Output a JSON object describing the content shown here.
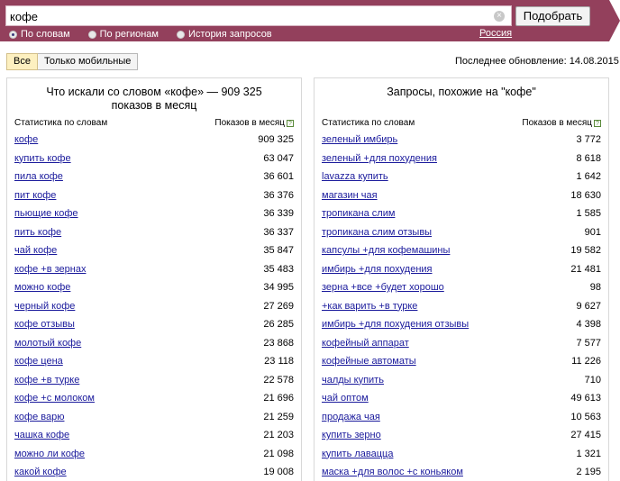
{
  "search": {
    "value": "кофе",
    "clear_icon": "×",
    "submit_label": "Подобрать"
  },
  "tabs": [
    {
      "label": "По словам",
      "selected": true
    },
    {
      "label": "По регионам",
      "selected": false
    },
    {
      "label": "История запросов",
      "selected": false
    }
  ],
  "region": "Россия",
  "filters": {
    "all_label": "Все",
    "mobile_label": "Только мобильные"
  },
  "last_update": "Последнее обновление: 14.08.2015",
  "colors": {
    "header_bg": "#93405c",
    "link": "#1a1a9c",
    "active_filter": "#fdf0c0"
  },
  "left_panel": {
    "title": "Что искали со словом «кофе» — 909 325 показов в месяц",
    "col_left": "Статистика по словам",
    "col_right": "Показов в месяц",
    "help_icon": "?",
    "rows": [
      {
        "kw": "кофе",
        "count": "909 325"
      },
      {
        "kw": "купить кофе",
        "count": "63 047"
      },
      {
        "kw": "пила кофе",
        "count": "36 601"
      },
      {
        "kw": "пит кофе",
        "count": "36 376"
      },
      {
        "kw": "пьющие кофе",
        "count": "36 339"
      },
      {
        "kw": "пить кофе",
        "count": "36 337"
      },
      {
        "kw": "чай кофе",
        "count": "35 847"
      },
      {
        "kw": "кофе +в зернах",
        "count": "35 483"
      },
      {
        "kw": "можно кофе",
        "count": "34 995"
      },
      {
        "kw": "черный кофе",
        "count": "27 269"
      },
      {
        "kw": "кофе отзывы",
        "count": "26 285"
      },
      {
        "kw": "молотый кофе",
        "count": "23 868"
      },
      {
        "kw": "кофе цена",
        "count": "23 118"
      },
      {
        "kw": "кофе +в турке",
        "count": "22 578"
      },
      {
        "kw": "кофе +с молоком",
        "count": "21 696"
      },
      {
        "kw": "кофе варю",
        "count": "21 259"
      },
      {
        "kw": "чашка кофе",
        "count": "21 203"
      },
      {
        "kw": "можно ли кофе",
        "count": "21 098"
      },
      {
        "kw": "какой кофе",
        "count": "19 008"
      }
    ]
  },
  "right_panel": {
    "title": "Запросы, похожие на \"кофе\"",
    "col_left": "Статистика по словам",
    "col_right": "Показов в месяц",
    "help_icon": "?",
    "rows": [
      {
        "kw": "зеленый имбирь",
        "count": "3 772"
      },
      {
        "kw": "зеленый +для похудения",
        "count": "8 618"
      },
      {
        "kw": "lavazza купить",
        "count": "1 642"
      },
      {
        "kw": "магазин чая",
        "count": "18 630"
      },
      {
        "kw": "тропикана слим",
        "count": "1 585"
      },
      {
        "kw": "тропикана слим отзывы",
        "count": "901"
      },
      {
        "kw": "капсулы +для кофемашины",
        "count": "19 582"
      },
      {
        "kw": "имбирь +для похудения",
        "count": "21 481"
      },
      {
        "kw": "зерна +все +будет хорошо",
        "count": "98"
      },
      {
        "kw": "+как варить +в турке",
        "count": "9 627"
      },
      {
        "kw": "имбирь +для похудения отзывы",
        "count": "4 398"
      },
      {
        "kw": "кофейный аппарат",
        "count": "7 577"
      },
      {
        "kw": "кофейные автоматы",
        "count": "11 226"
      },
      {
        "kw": "чалды купить",
        "count": "710"
      },
      {
        "kw": "чай оптом",
        "count": "49 613"
      },
      {
        "kw": "продажа чая",
        "count": "10 563"
      },
      {
        "kw": "купить зерно",
        "count": "27 415"
      },
      {
        "kw": "купить лавацца",
        "count": "1 321"
      },
      {
        "kw": "маска +для волос +с коньяком",
        "count": "2 195"
      }
    ]
  }
}
